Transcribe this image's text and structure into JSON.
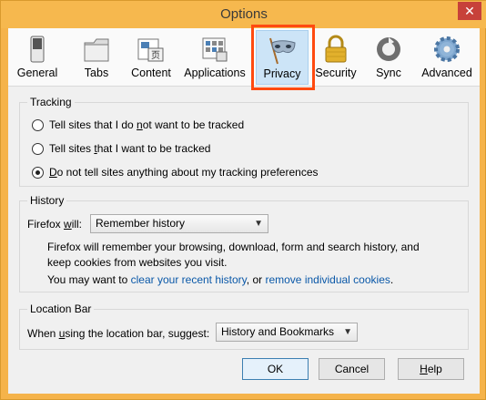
{
  "window": {
    "title": "Options",
    "close_label": "✕"
  },
  "toolbar": {
    "items": [
      {
        "label": "General"
      },
      {
        "label": "Tabs"
      },
      {
        "label": "Content"
      },
      {
        "label": "Applications"
      },
      {
        "label": "Privacy",
        "selected": true
      },
      {
        "label": "Security"
      },
      {
        "label": "Sync"
      },
      {
        "label": "Advanced"
      }
    ]
  },
  "tracking": {
    "legend": "Tracking",
    "options": [
      {
        "pre": "Tell sites that I do ",
        "acc": "n",
        "post": "ot want to be tracked",
        "checked": false
      },
      {
        "pre": "Tell sites ",
        "acc": "t",
        "post": "hat I want to be tracked",
        "checked": false
      },
      {
        "pre": "",
        "acc": "D",
        "post": "o not tell sites anything about my tracking preferences",
        "checked": true
      }
    ]
  },
  "history": {
    "legend": "History",
    "firefox_will_pre": "Firefox ",
    "firefox_will_acc": "w",
    "firefox_will_post": "ill:",
    "select_value": "Remember history",
    "desc_line1": "Firefox will remember your browsing, download, form and search history, and",
    "desc_line2": "keep cookies from websites you visit.",
    "may_want_pre": "You may want to ",
    "link_clear": "clear your recent history",
    "may_want_mid": ", or ",
    "link_remove": "remove individual cookies",
    "may_want_post": "."
  },
  "location_bar": {
    "legend": "Location Bar",
    "label_pre": "When ",
    "label_acc": "u",
    "label_post": "sing the location bar, suggest:",
    "select_value": "History and Bookmarks"
  },
  "buttons": {
    "ok": "OK",
    "cancel": "Cancel",
    "help_acc": "H",
    "help_post": "elp"
  },
  "colors": {
    "highlight": "#ff4a10",
    "link": "#0a58a8",
    "selected_tab": "#cce4f7"
  }
}
